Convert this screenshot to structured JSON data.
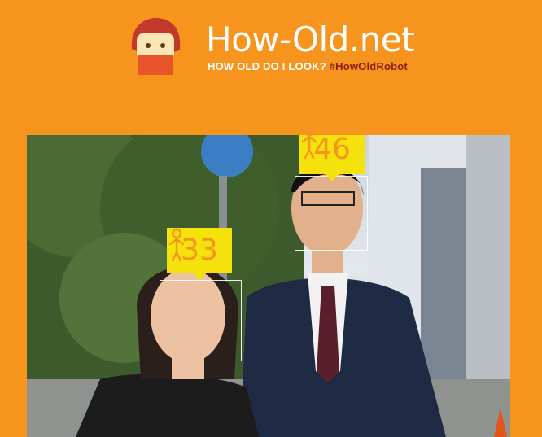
{
  "header": {
    "title": "How-Old.net",
    "tagline": "HOW OLD DO I LOOK?",
    "hashtag": "#HowOldRobot"
  },
  "colors": {
    "background": "#f7941d",
    "label_bg": "#f5e10b",
    "label_text": "#f7941d",
    "hashtag": "#8b1f12"
  },
  "detections": [
    {
      "age": "46",
      "icon": "person-icon"
    },
    {
      "age": "33",
      "icon": "person-icon"
    }
  ]
}
